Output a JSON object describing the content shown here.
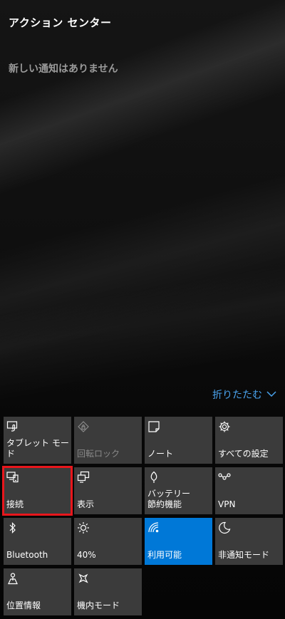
{
  "header": {
    "title": "アクション センター"
  },
  "notifications": {
    "empty_message": "新しい通知はありません"
  },
  "collapse": {
    "label": "折りたたむ"
  },
  "colors": {
    "accent": "#0078d7",
    "tile": "#3b3b3b",
    "link": "#4aa3ee",
    "highlight_box": "#e8161c"
  },
  "tiles": [
    {
      "label": "タブレット モード",
      "icon": "tablet-mode-icon",
      "state": "normal"
    },
    {
      "label": "回転ロック",
      "icon": "rotation-lock-icon",
      "state": "disabled"
    },
    {
      "label": "ノート",
      "icon": "note-icon",
      "state": "normal"
    },
    {
      "label": "すべての設定",
      "icon": "gear-icon",
      "state": "normal"
    },
    {
      "label": "接続",
      "icon": "connect-icon",
      "state": "normal",
      "highlighted": true
    },
    {
      "label": "表示",
      "icon": "project-icon",
      "state": "normal"
    },
    {
      "label": "バッテリー\n節約機能",
      "icon": "battery-saver-icon",
      "state": "normal"
    },
    {
      "label": "VPN",
      "icon": "vpn-icon",
      "state": "normal"
    },
    {
      "label": "Bluetooth",
      "icon": "bluetooth-icon",
      "state": "normal"
    },
    {
      "label": "40%",
      "icon": "brightness-icon",
      "state": "normal"
    },
    {
      "label": "利用可能",
      "icon": "wifi-icon",
      "state": "active"
    },
    {
      "label": "非通知モード",
      "icon": "quiet-hours-icon",
      "state": "normal"
    },
    {
      "label": "位置情報",
      "icon": "location-icon",
      "state": "normal"
    },
    {
      "label": "機内モード",
      "icon": "airplane-icon",
      "state": "normal"
    }
  ]
}
